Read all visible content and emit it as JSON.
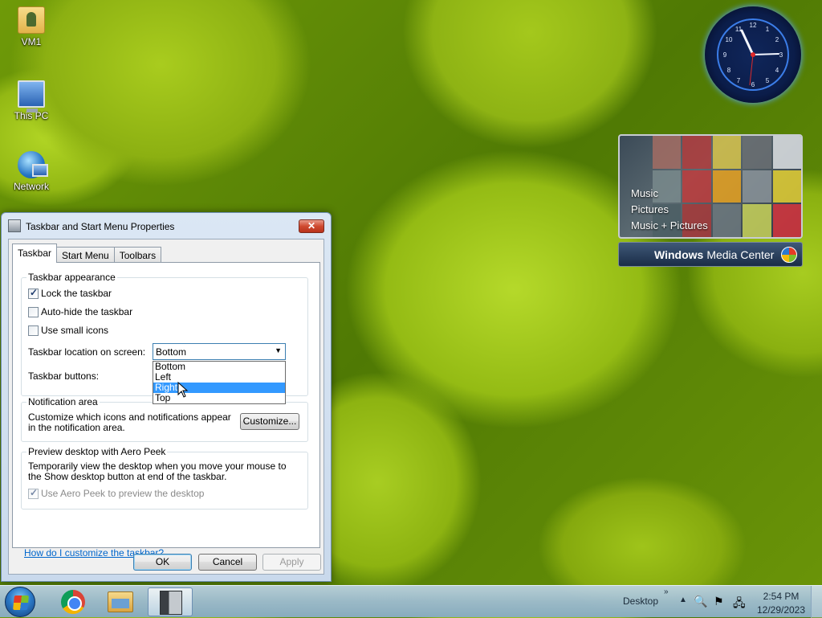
{
  "desktop": {
    "icons": [
      {
        "label": "VM1",
        "icon": "user-folder-icon"
      },
      {
        "label": "This PC",
        "icon": "computer-icon"
      },
      {
        "label": "Network",
        "icon": "network-icon"
      }
    ]
  },
  "media_center": {
    "menu": [
      "Music",
      "Pictures",
      "Music + Pictures"
    ],
    "brand_bold": "Windows",
    "brand_rest": "Media Center"
  },
  "dialog": {
    "title": "Taskbar and Start Menu Properties",
    "close_label": "✕",
    "tabs": [
      "Taskbar",
      "Start Menu",
      "Toolbars"
    ],
    "active_tab": "Taskbar",
    "taskbar_appearance": {
      "group_title": "Taskbar appearance",
      "lock_label": "Lock the taskbar",
      "lock_checked": true,
      "autohide_label": "Auto-hide the taskbar",
      "autohide_checked": false,
      "small_icons_label": "Use small icons",
      "small_icons_checked": false,
      "location_label": "Taskbar location on screen:",
      "location_value": "Bottom",
      "location_options": [
        "Bottom",
        "Left",
        "Right",
        "Top"
      ],
      "location_highlighted": "Right",
      "buttons_label": "Taskbar buttons:"
    },
    "notification_area": {
      "group_title": "Notification area",
      "description": "Customize which icons and notifications appear in the notification area.",
      "customize_label": "Customize..."
    },
    "aero_peek": {
      "group_title": "Preview desktop with Aero Peek",
      "description": "Temporarily view the desktop when you move your mouse to the Show desktop button at end of the taskbar.",
      "checkbox_label": "Use Aero Peek to preview the desktop",
      "checked": true,
      "enabled": false
    },
    "help_link": "How do I customize the taskbar?",
    "buttons": {
      "ok": "OK",
      "cancel": "Cancel",
      "apply": "Apply"
    }
  },
  "taskbar": {
    "apps": [
      "start-orb",
      "chrome",
      "file-explorer",
      "properties"
    ],
    "toolbar_label": "Desktop",
    "toolbar_chevron": "»",
    "tray_expand": "▲",
    "time": "2:54 PM",
    "date": "12/29/2023"
  },
  "colors": {
    "selection": "#3399ff",
    "link": "#0066cc",
    "close_button": "#cf4a30"
  }
}
